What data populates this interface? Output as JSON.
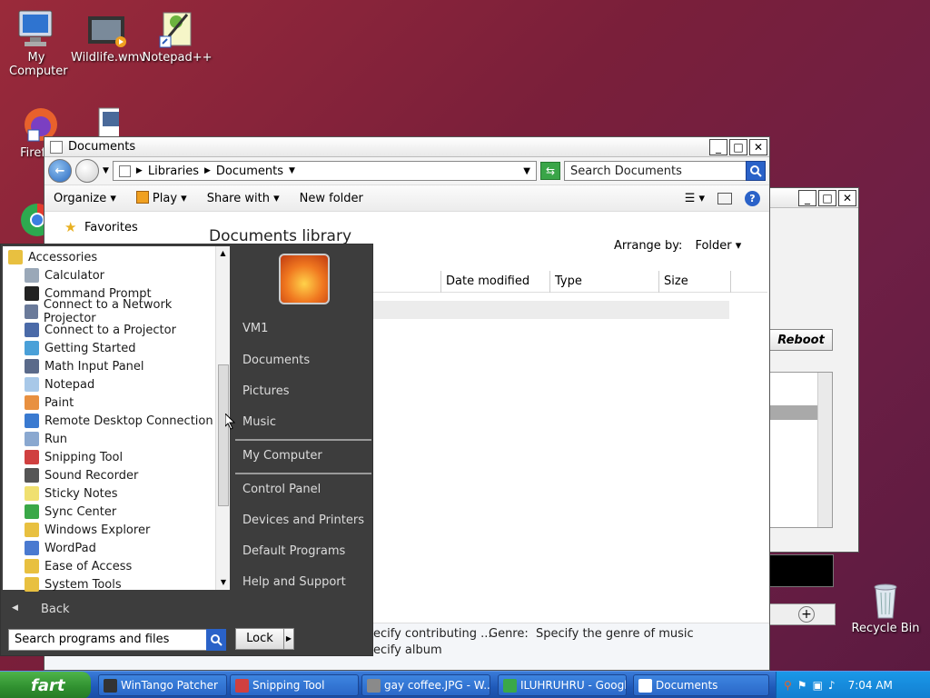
{
  "desktop": {
    "icons": [
      {
        "label": "My Computer"
      },
      {
        "label": "Wildlife.wmv"
      },
      {
        "label": "Notepad++"
      },
      {
        "label": "Firefo"
      },
      {
        "label": "Recycle Bin"
      }
    ]
  },
  "explorer": {
    "title": "Documents",
    "breadcrumb": [
      "Libraries",
      "Documents"
    ],
    "search_placeholder": "Search Documents",
    "toolbar": [
      "Organize",
      "Play",
      "Share with",
      "New folder"
    ],
    "nav_favorites": "Favorites",
    "library_title": "Documents library",
    "arrange_label": "Arrange by:",
    "arrange_value": "Folder",
    "columns": [
      "Date modified",
      "Type",
      "Size"
    ],
    "details_line1": "ecify contributing ...",
    "details_genre": "Genre:  Specify the genre of music",
    "details_line2": "ecify album"
  },
  "bg_window": {
    "reboot_label": "Reboot"
  },
  "startmenu": {
    "programs": [
      {
        "label": "Accessories",
        "icon": "folder-icon",
        "indent": false
      },
      {
        "label": "Calculator",
        "icon": "calculator-icon",
        "indent": true
      },
      {
        "label": "Command Prompt",
        "icon": "cmd-icon",
        "indent": true
      },
      {
        "label": "Connect to a Network Projector",
        "icon": "network-projector-icon",
        "indent": true
      },
      {
        "label": "Connect to a Projector",
        "icon": "projector-icon",
        "indent": true
      },
      {
        "label": "Getting Started",
        "icon": "getting-started-icon",
        "indent": true
      },
      {
        "label": "Math Input Panel",
        "icon": "math-input-icon",
        "indent": true
      },
      {
        "label": "Notepad",
        "icon": "notepad-icon",
        "indent": true
      },
      {
        "label": "Paint",
        "icon": "paint-icon",
        "indent": true
      },
      {
        "label": "Remote Desktop Connection",
        "icon": "remote-desktop-icon",
        "indent": true
      },
      {
        "label": "Run",
        "icon": "run-icon",
        "indent": true
      },
      {
        "label": "Snipping Tool",
        "icon": "snipping-tool-icon",
        "indent": true
      },
      {
        "label": "Sound Recorder",
        "icon": "microphone-icon",
        "indent": true
      },
      {
        "label": "Sticky Notes",
        "icon": "sticky-notes-icon",
        "indent": true
      },
      {
        "label": "Sync Center",
        "icon": "sync-icon",
        "indent": true
      },
      {
        "label": "Windows Explorer",
        "icon": "folder-icon",
        "indent": true
      },
      {
        "label": "WordPad",
        "icon": "wordpad-icon",
        "indent": true
      },
      {
        "label": "Ease of Access",
        "icon": "folder-icon",
        "indent": true
      },
      {
        "label": "System Tools",
        "icon": "folder-icon",
        "indent": true
      }
    ],
    "back_label": "Back",
    "search_placeholder": "Search programs and files",
    "lock_label": "Lock",
    "right_items": [
      {
        "label": "VM1"
      },
      {
        "label": "Documents"
      },
      {
        "label": "Pictures"
      },
      {
        "label": "Music"
      },
      {
        "label": "My Computer"
      },
      {
        "label": "Control Panel"
      },
      {
        "label": "Devices and Printers"
      },
      {
        "label": "Default Programs"
      },
      {
        "label": "Help and Support"
      }
    ]
  },
  "taskbar": {
    "start_label": "fart",
    "tasks": [
      {
        "label": "WinTango Patcher"
      },
      {
        "label": "Snipping Tool"
      },
      {
        "label": "gay coffee.JPG - W..."
      },
      {
        "label": "ILUHRUHRU - Googl..."
      },
      {
        "label": "Documents"
      }
    ],
    "clock": "7:04 AM"
  }
}
